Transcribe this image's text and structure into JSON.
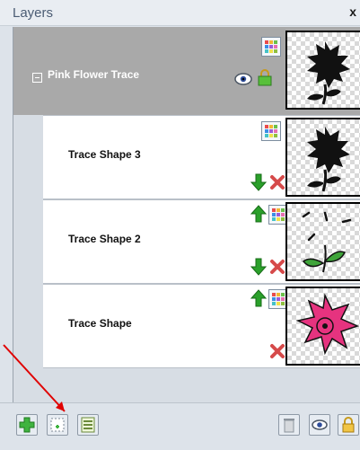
{
  "panel": {
    "title": "Layers",
    "close_label": "x"
  },
  "group": {
    "collapse_symbol": "−",
    "label": "Pink Flower Trace"
  },
  "rows": [
    {
      "label": "Trace Shape 3"
    },
    {
      "label": "Trace Shape 2"
    },
    {
      "label": "Trace Shape"
    }
  ],
  "colors": {
    "group_bg": "#a9a9a9",
    "row_bg": "#ffffff",
    "arrow_green": "#2aa02a",
    "delete_red": "#d64a4a",
    "flower_pink": "#e6337f",
    "annotation_arrow": "#e00000"
  },
  "icons": [
    "color-grid-icon",
    "eye-icon",
    "lock-icon",
    "move-up-icon",
    "move-down-icon",
    "delete-icon",
    "add-layer-icon",
    "new-layer-icon",
    "layer-properties-icon",
    "trash-icon",
    "visibility-icon",
    "lock-layer-icon"
  ]
}
